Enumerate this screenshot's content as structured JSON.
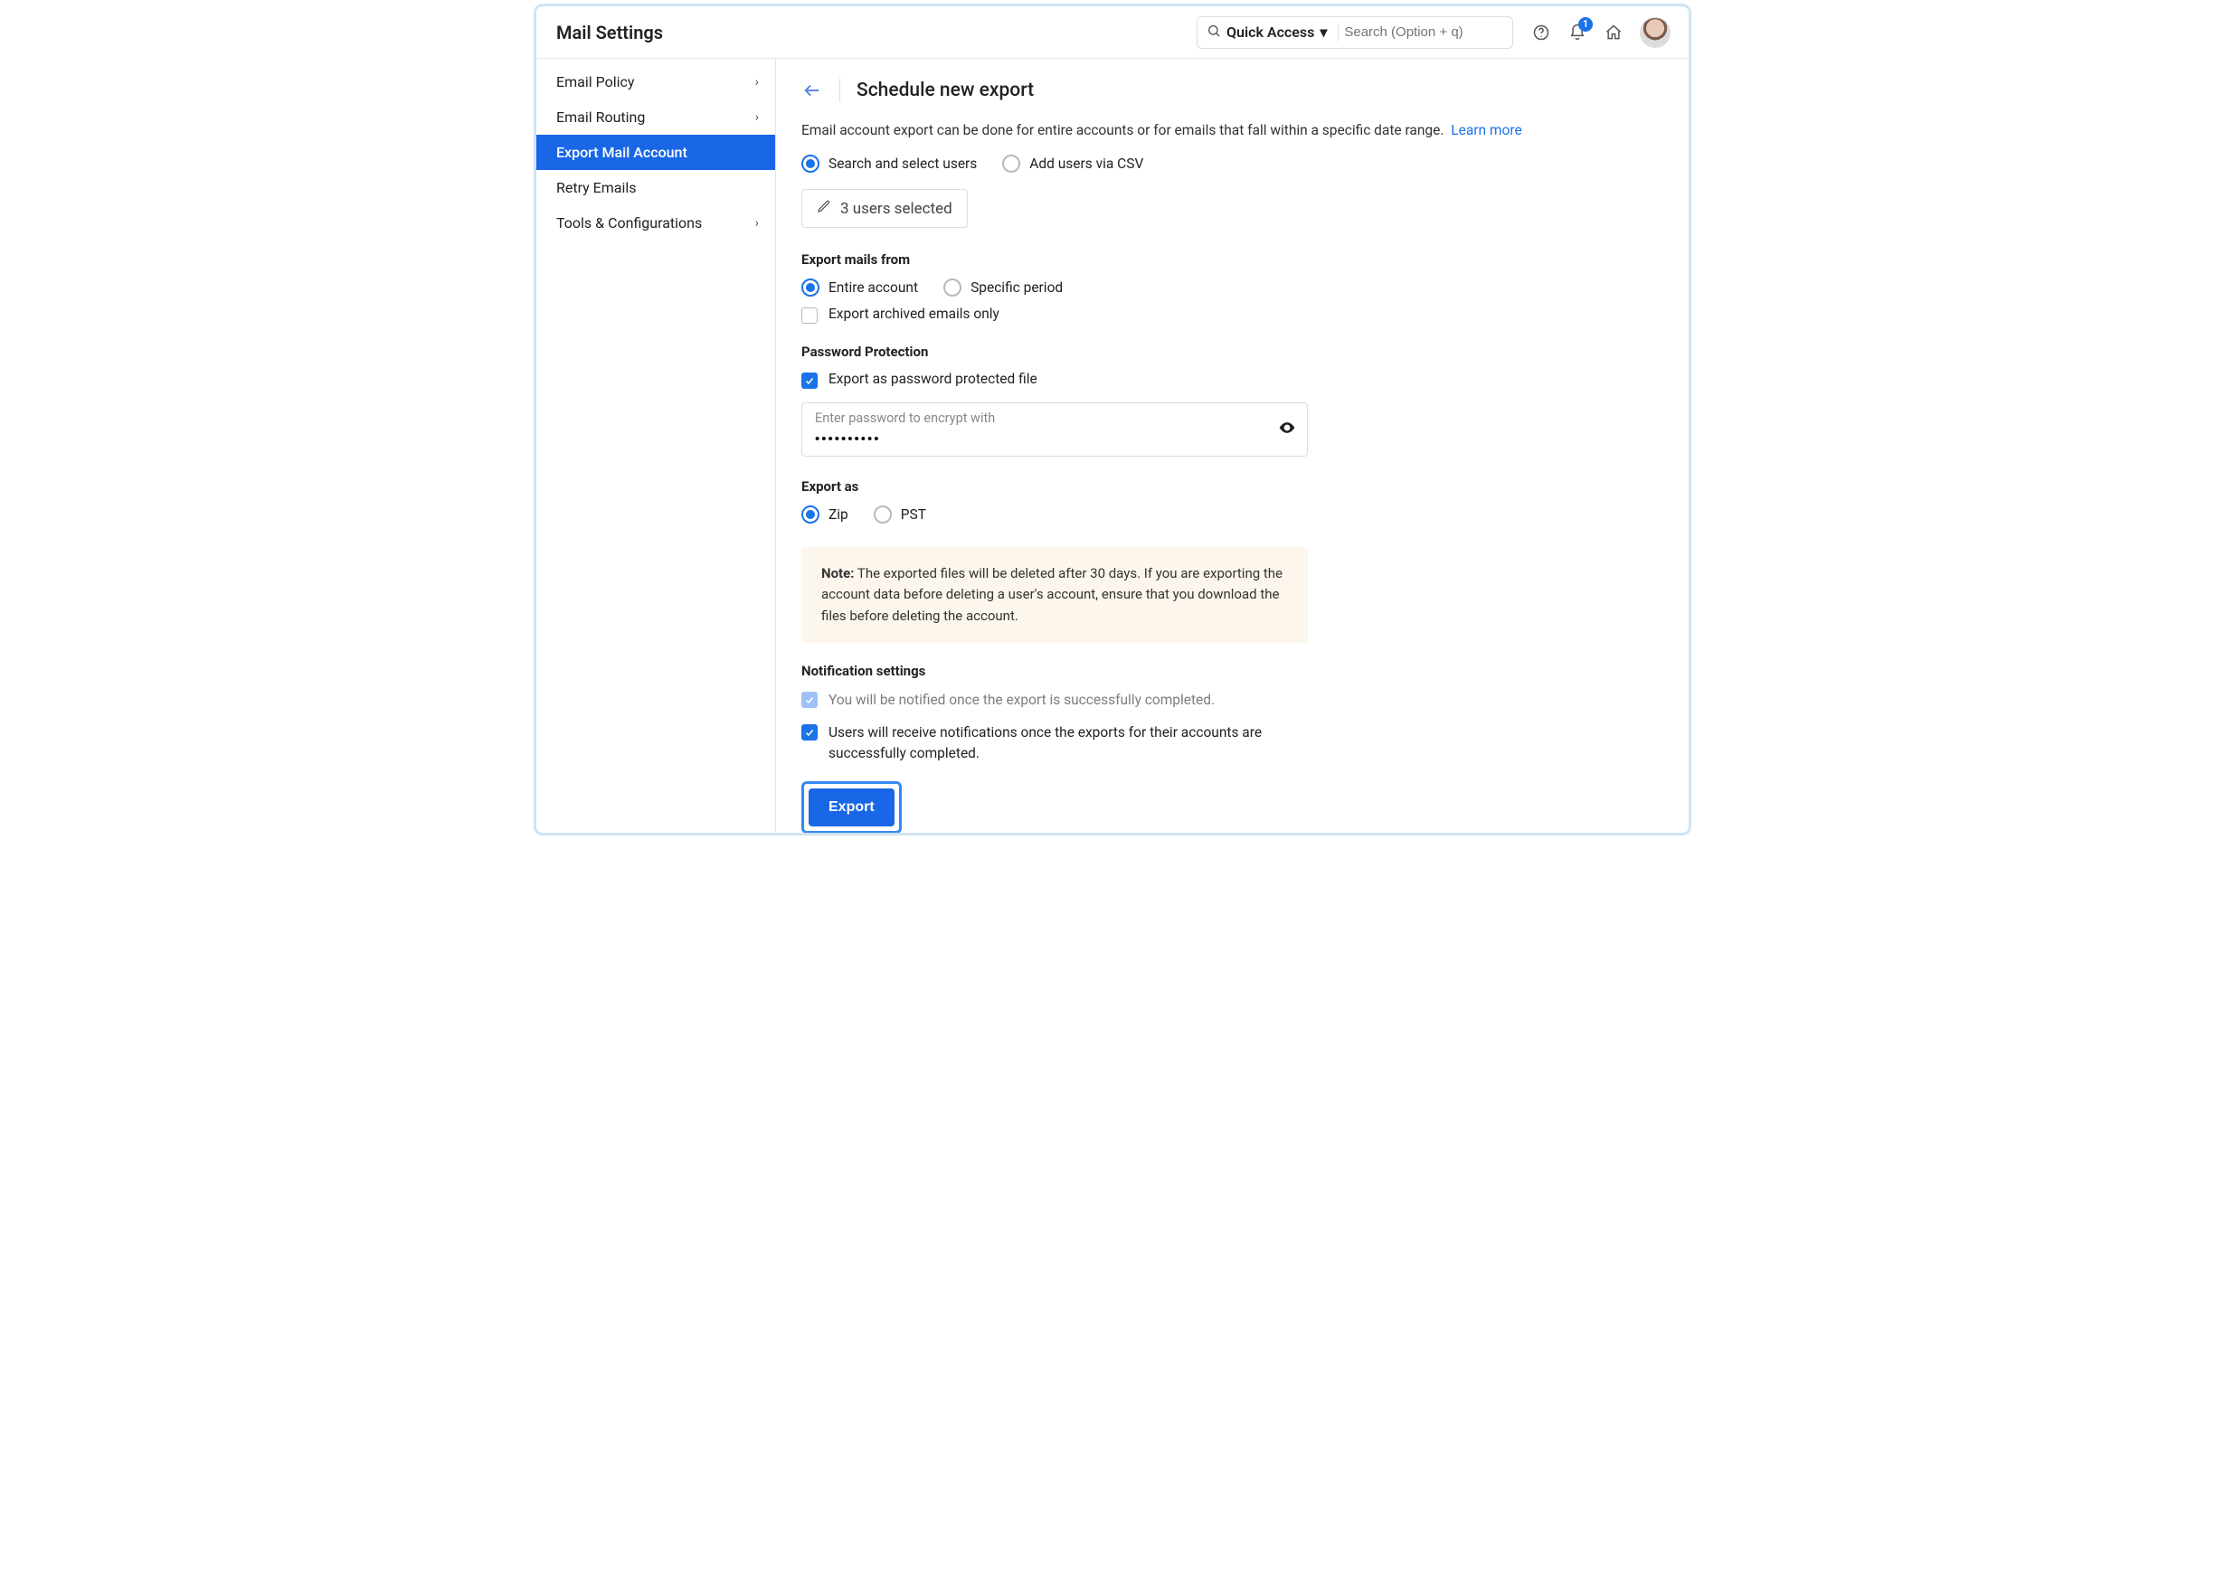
{
  "colors": {
    "accent": "#1a73e8"
  },
  "header": {
    "title": "Mail Settings",
    "quick_access": "Quick Access",
    "search_placeholder": "Search (Option + q)",
    "notification_count": "1"
  },
  "sidebar": {
    "items": [
      {
        "label": "Email Policy",
        "has_children": true,
        "active": false
      },
      {
        "label": "Email Routing",
        "has_children": true,
        "active": false
      },
      {
        "label": "Export Mail Account",
        "has_children": false,
        "active": true
      },
      {
        "label": "Retry Emails",
        "has_children": false,
        "active": false
      },
      {
        "label": "Tools & Configurations",
        "has_children": true,
        "active": false
      }
    ]
  },
  "page": {
    "title": "Schedule new export",
    "description": "Email account export can be done for entire accounts or for emails that fall within a specific date range.",
    "learn_more": "Learn more",
    "user_mode": {
      "search_select": "Search and select users",
      "csv": "Add users via CSV",
      "selected": "search"
    },
    "users_selected_label": "3 users selected",
    "export_from": {
      "label": "Export mails from",
      "entire": "Entire account",
      "specific": "Specific period",
      "selected": "entire",
      "archived_only": "Export archived emails only",
      "archived_checked": false
    },
    "password": {
      "label": "Password Protection",
      "checkbox": "Export as password protected file",
      "checked": true,
      "field_label": "Enter password to encrypt with",
      "value": "••••••••••"
    },
    "export_as": {
      "label": "Export as",
      "zip": "Zip",
      "pst": "PST",
      "selected": "zip"
    },
    "note": {
      "prefix": "Note:",
      "text": " The exported files will be deleted after 30 days. If you are exporting the account data before deleting a user's account, ensure that you download the files before deleting the account."
    },
    "notifications": {
      "label": "Notification settings",
      "self": "You will be notified once the export is successfully completed.",
      "users": "Users will receive notifications once the exports for their accounts are successfully completed."
    },
    "export_button": "Export"
  }
}
